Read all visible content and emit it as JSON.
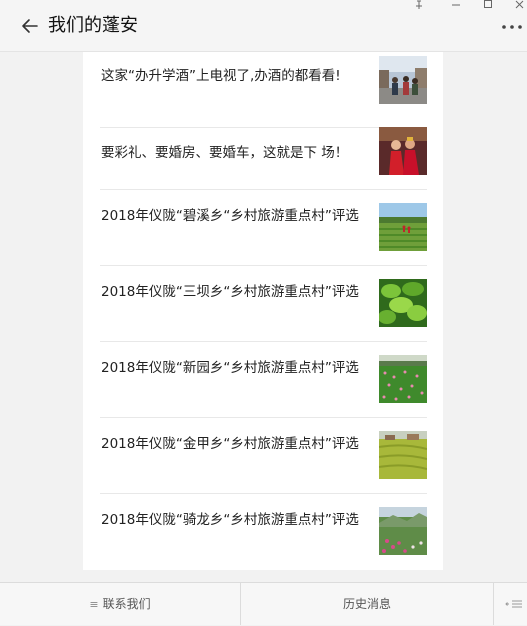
{
  "window": {
    "title": "我们的蓬安",
    "controls": [
      "pin-icon",
      "minimize-icon",
      "maximize-icon",
      "close-icon"
    ]
  },
  "articles": [
    {
      "title": "这家“办升学酒”上电视了,办酒的都看看!",
      "thumb": "street-crowd-photo"
    },
    {
      "title": "要彩礼、要婚房、要婚车，这就是下 场！",
      "thumb": "wedding-photo"
    },
    {
      "title": "2018年仪陇“碧溪乡“乡村旅游重点村”评选",
      "thumb": "tea-field-photo"
    },
    {
      "title": "2018年仪陇“三坝乡“乡村旅游重点村”评选",
      "thumb": "green-leaves-photo"
    },
    {
      "title": "2018年仪陇“新园乡“乡村旅游重点村”评选",
      "thumb": "flower-field-photo"
    },
    {
      "title": "2018年仪陇“金甲乡“乡村旅游重点村”评选",
      "thumb": "village-field-photo"
    },
    {
      "title": "2018年仪陇“骑龙乡“乡村旅游重点村”评选",
      "thumb": "hillside-flowers-photo"
    }
  ],
  "bottom_menu": {
    "contact_label": "联系我们",
    "history_label": "历史消息"
  },
  "colors": {
    "titlebar_bg": "#f5f5f5",
    "page_bg": "#f2f2f2",
    "card_bg": "#ffffff"
  }
}
